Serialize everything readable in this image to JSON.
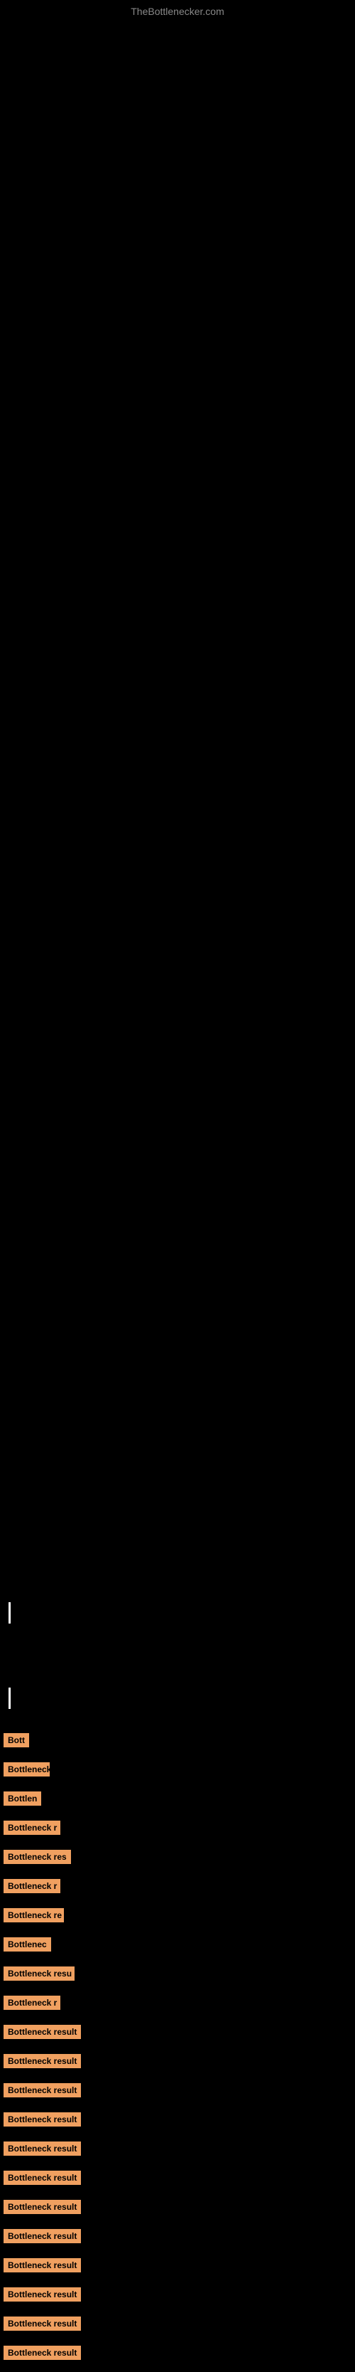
{
  "site": {
    "title": "TheBottlenecker.com"
  },
  "results": [
    {
      "label": "Bott",
      "width_class": "badge-w1"
    },
    {
      "label": "Bottleneck",
      "width_class": "badge-w2"
    },
    {
      "label": "Bottlen",
      "width_class": "badge-w3"
    },
    {
      "label": "Bottleneck r",
      "width_class": "badge-w4"
    },
    {
      "label": "Bottleneck res",
      "width_class": "badge-w5"
    },
    {
      "label": "Bottleneck r",
      "width_class": "badge-w4"
    },
    {
      "label": "Bottleneck re",
      "width_class": "badge-w6"
    },
    {
      "label": "Bottlenec",
      "width_class": "badge-w8"
    },
    {
      "label": "Bottleneck resu",
      "width_class": "badge-w9"
    },
    {
      "label": "Bottleneck r",
      "width_class": "badge-w4"
    },
    {
      "label": "Bottleneck result",
      "width_class": "badge-w10"
    },
    {
      "label": "Bottleneck result",
      "width_class": "badge-w11"
    },
    {
      "label": "Bottleneck result",
      "width_class": "badge-w12"
    },
    {
      "label": "Bottleneck result",
      "width_class": "badge-full"
    },
    {
      "label": "Bottleneck result",
      "width_class": "badge-full"
    },
    {
      "label": "Bottleneck result",
      "width_class": "badge-full"
    },
    {
      "label": "Bottleneck result",
      "width_class": "badge-full"
    },
    {
      "label": "Bottleneck result",
      "width_class": "badge-full"
    },
    {
      "label": "Bottleneck result",
      "width_class": "badge-full"
    },
    {
      "label": "Bottleneck result",
      "width_class": "badge-full"
    },
    {
      "label": "Bottleneck result",
      "width_class": "badge-full"
    },
    {
      "label": "Bottleneck result",
      "width_class": "badge-full"
    }
  ]
}
